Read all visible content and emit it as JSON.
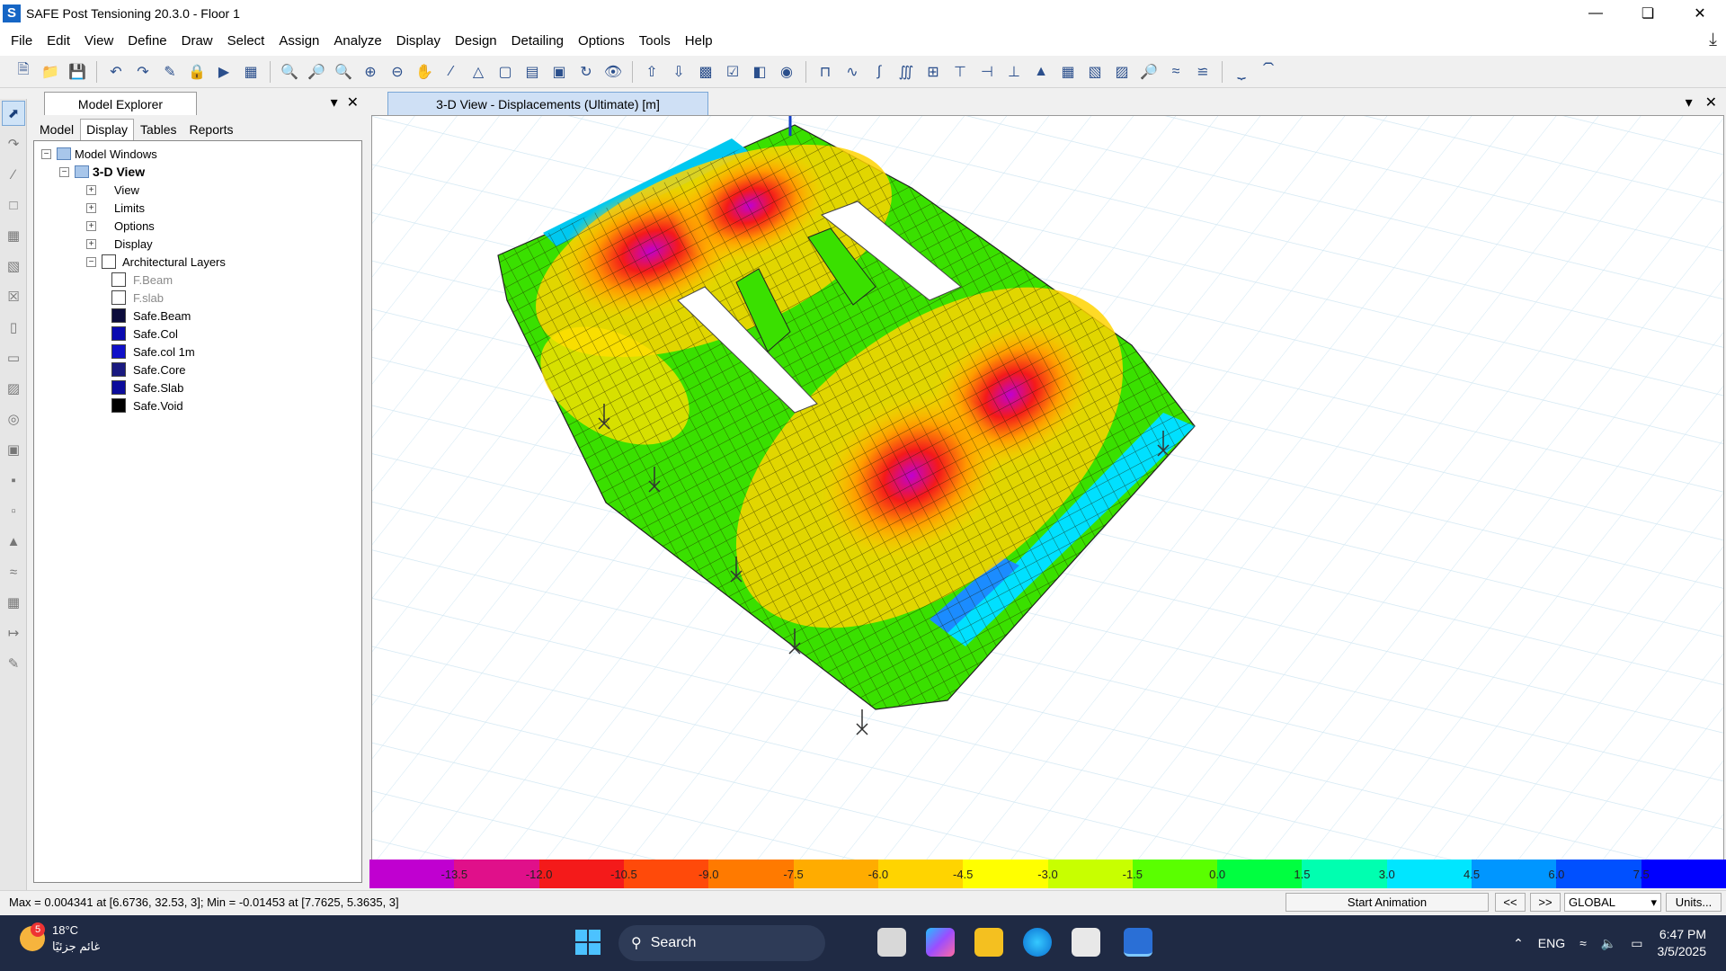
{
  "window": {
    "title": "SAFE Post Tensioning 20.3.0 - Floor 1",
    "logo_letter": "S",
    "controls": [
      "minimize",
      "maximize",
      "close"
    ]
  },
  "menu": [
    "File",
    "Edit",
    "View",
    "Define",
    "Draw",
    "Select",
    "Assign",
    "Analyze",
    "Display",
    "Design",
    "Detailing",
    "Options",
    "Tools",
    "Help"
  ],
  "explorer": {
    "title": "Model Explorer",
    "subtabs": [
      "Model",
      "Display",
      "Tables",
      "Reports"
    ],
    "active_subtab": "Display",
    "tree": {
      "root": "Model Windows",
      "view": "3-D View",
      "children": [
        "View",
        "Limits",
        "Options",
        "Display"
      ],
      "layers_label": "Architectural Layers",
      "layers": [
        {
          "name": "F.Beam",
          "color": "#ffffff",
          "grayed": true
        },
        {
          "name": "F.slab",
          "color": "#ffffff",
          "grayed": true
        },
        {
          "name": "Safe.Beam",
          "color": "#0b0b3b",
          "grayed": false
        },
        {
          "name": "Safe.Col",
          "color": "#0a0ab0",
          "grayed": false
        },
        {
          "name": "Safe.col 1m",
          "color": "#1010c8",
          "grayed": false
        },
        {
          "name": "Safe.Core",
          "color": "#1a1a80",
          "grayed": false
        },
        {
          "name": "Safe.Slab",
          "color": "#0c0c9c",
          "grayed": false
        },
        {
          "name": "Safe.Void",
          "color": "#000000",
          "grayed": false
        }
      ]
    }
  },
  "view": {
    "tab_title": "3-D View  - Displacements (Ultimate)  [m]"
  },
  "legend": {
    "values": [
      "-13.5",
      "-12.0",
      "-10.5",
      "-9.0",
      "-7.5",
      "-6.0",
      "-4.5",
      "-3.0",
      "-1.5",
      "0.0",
      "1.5",
      "3.0",
      "4.5",
      "6.0",
      "7.5"
    ],
    "colors": [
      "#c000d0",
      "#e0108a",
      "#f41a1a",
      "#ff4a0a",
      "#ff7a00",
      "#ffac00",
      "#ffd400",
      "#ffff00",
      "#c8ff00",
      "#5aff00",
      "#00ff40",
      "#00ffb0",
      "#00e6ff",
      "#0096ff",
      "#0050ff",
      "#0000ff"
    ]
  },
  "status": {
    "text": "Max = 0.004341 at [6.6736, 32.53, 3];  Min = -0.01453 at [7.7625, 5.3635, 3]",
    "start_animation": "Start Animation",
    "prev": "<<",
    "next": ">>",
    "coord_system": "GLOBAL",
    "units": "Units..."
  },
  "taskbar": {
    "weather_temp": "18°C",
    "weather_desc": "غائم جزئيًا",
    "weather_badge": "5",
    "search_placeholder": "Search",
    "language": "ENG",
    "time": "6:47 PM",
    "date": "3/5/2025"
  }
}
